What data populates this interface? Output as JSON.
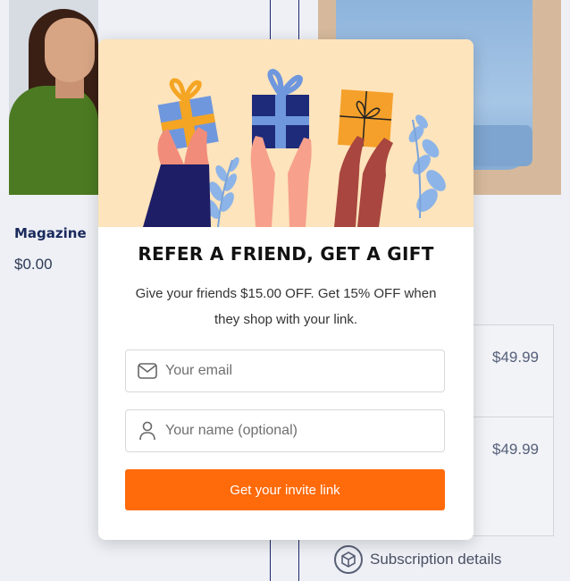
{
  "background": {
    "product_name": "Magazine",
    "product_price": "$0.00",
    "price_rows": [
      "$49.99",
      "$49.99"
    ],
    "subscription_label": "Subscription details"
  },
  "popup": {
    "title": "REFER A FRIEND, GET A GIFT",
    "description": "Give your friends $15.00 OFF. Get 15% OFF when they shop with your link.",
    "email_placeholder": "Your email",
    "name_placeholder": "Your name (optional)",
    "button_label": "Get your invite link",
    "icons": {
      "email": "envelope-icon",
      "name": "user-icon"
    }
  },
  "colors": {
    "accent": "#ff6a0a",
    "banner_bg": "#fde4bc",
    "navy": "#1b2a6b"
  }
}
